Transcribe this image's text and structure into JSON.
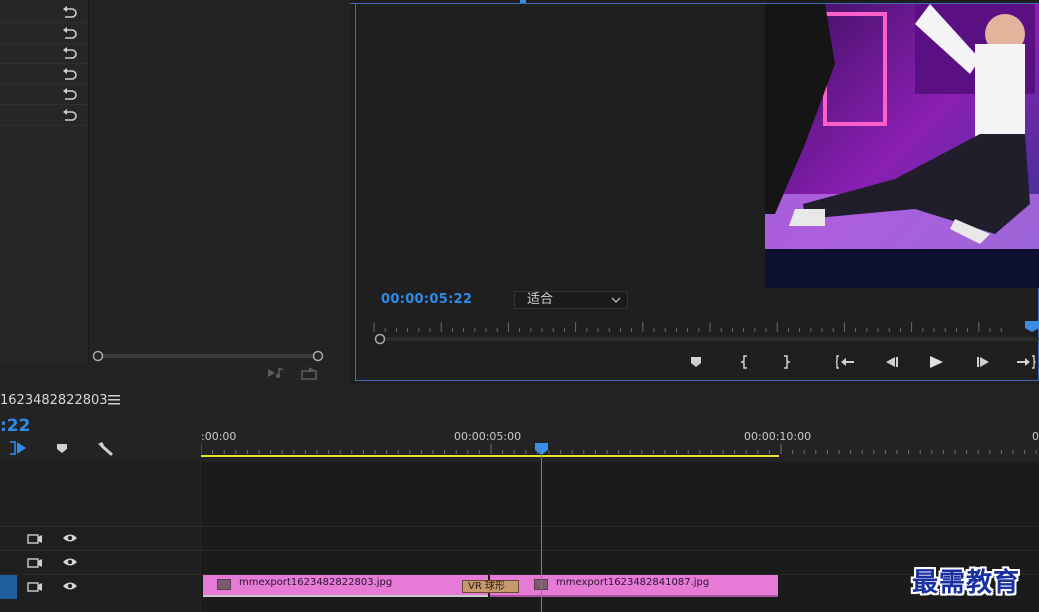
{
  "program": {
    "timecode": "00:00:05:22",
    "fit_value": "适合",
    "transport_icons": [
      "marker-icon",
      "mark-in-icon",
      "mark-out-icon",
      "go-to-in-icon",
      "step-back-icon",
      "play-icon",
      "step-forward-icon",
      "go-to-out-icon"
    ]
  },
  "effect_controls": {
    "reset_rows": 6,
    "bottom_icons": [
      "play-audio-icon",
      "export-icon"
    ]
  },
  "timeline": {
    "sequence_title": "1623482822803",
    "timecode": ":22",
    "ruler_labels": [
      ":00:00",
      "00:00:05:00",
      "00:00:10:00",
      "0"
    ],
    "tool_icons": [
      "snap-icon",
      "add-marker-icon",
      "wrench-icon"
    ],
    "clips": [
      {
        "name": "mmexport1623482822803.jpg"
      },
      {
        "name": "mmexport1623482841087.jpg"
      }
    ],
    "transition_label": "VR 球形",
    "playhead_time": "00:00:05:22",
    "colors": {
      "accent": "#2d8ceb",
      "clip": "#e57ad7",
      "work_area": "#e8e231"
    }
  },
  "watermark": "最需教育"
}
